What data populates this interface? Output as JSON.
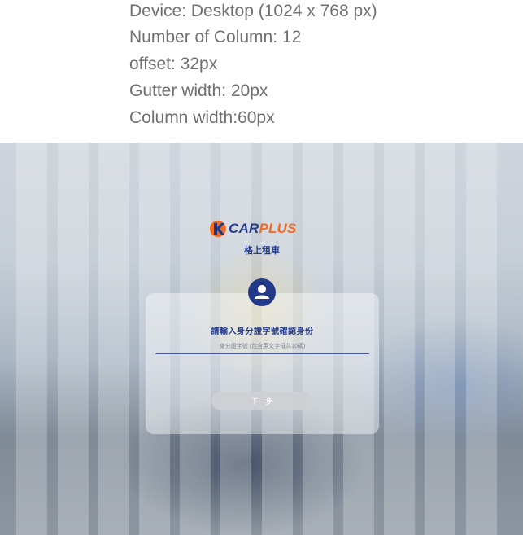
{
  "spec": {
    "lines": [
      "Device: Desktop (1024 x 768 px)",
      "Number of Column: 12",
      "offset: 32px",
      "Gutter width: 20px",
      "Column width:60px"
    ]
  },
  "brand": {
    "logo_part1": "CAR",
    "logo_part2": "PLUS",
    "subtitle": "格上租車",
    "colors": {
      "navy": "#233a8a",
      "orange": "#f26a21"
    }
  },
  "login": {
    "avatar_icon": "user-icon",
    "title": "請輸入身分證字號確認身份",
    "id_placeholder": "身分證字號 (包含英文字母共10碼)",
    "next_label": "下一步"
  }
}
